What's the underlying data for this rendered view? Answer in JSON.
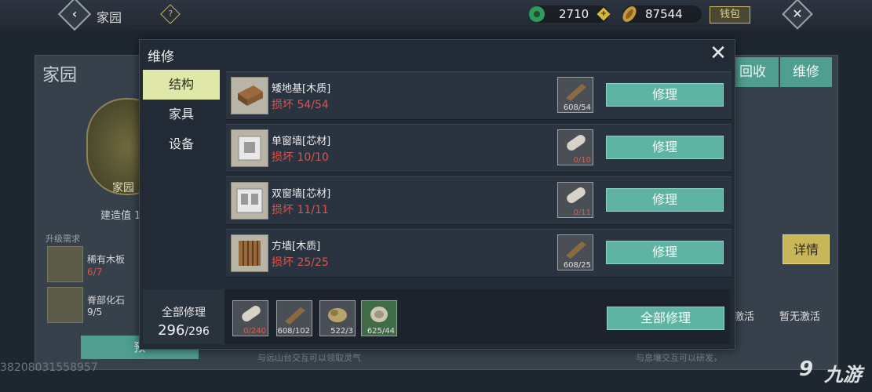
{
  "topbar": {
    "title": "家园",
    "back_icon": "chevron-left-icon",
    "help_icon": "help-icon",
    "jade_value": "2710",
    "coin_value": "87544",
    "wallet_label": "钱包",
    "close_icon": "close-icon"
  },
  "background": {
    "homeland_title": "家园",
    "emblem_label": "家园",
    "build_value": "建造值 1",
    "upgrade_title": "升级需求",
    "items": [
      {
        "name": "稀有木板",
        "count": "6/7"
      },
      {
        "name": "脊部化石",
        "count": "9/5"
      }
    ],
    "preview_label": "预",
    "uid": "38208031558957",
    "recycle_label": "回收",
    "repair_tab_label": "维修",
    "detail_label": "详情",
    "inactive_1": "激活",
    "inactive_2": "暂无激活",
    "hint_1": "与远山台交互可以领取灵气",
    "hint_2": "与息壤交互可以研发，"
  },
  "watermark": {
    "text": "九游",
    "mark": "9"
  },
  "modal": {
    "title": "维修",
    "tabs": [
      {
        "label": "结构",
        "active": true
      },
      {
        "label": "家具",
        "active": false
      },
      {
        "label": "设备",
        "active": false
      }
    ],
    "rows": [
      {
        "name": "矮地基[木质]",
        "damage": "损坏 54/54",
        "icon": "wood-foundation-icon",
        "material_icon": "wood-plank-icon",
        "material_count": "608/54",
        "material_red": false,
        "button": "修理"
      },
      {
        "name": "单窗墙[芯材]",
        "damage": "损坏 10/10",
        "icon": "single-window-wall-icon",
        "material_icon": "core-material-icon",
        "material_count": "0/10",
        "material_red": true,
        "button": "修理"
      },
      {
        "name": "双窗墙[芯材]",
        "damage": "损坏 11/11",
        "icon": "double-window-wall-icon",
        "material_icon": "core-material-icon",
        "material_count": "0/11",
        "material_red": true,
        "button": "修理"
      },
      {
        "name": "方墙[木质]",
        "damage": "损坏 25/25",
        "icon": "wood-wall-icon",
        "material_icon": "wood-plank-icon",
        "material_count": "608/25",
        "material_red": false,
        "button": "修理"
      }
    ],
    "footer": {
      "repair_all_label": "全部修理",
      "total_current": "296",
      "total_max": "/296",
      "materials": [
        {
          "icon": "core-material-icon",
          "count": "0/240",
          "red": true
        },
        {
          "icon": "wood-plank-icon",
          "count": "608/102",
          "red": false
        },
        {
          "icon": "ore-icon",
          "count": "522/3",
          "red": false
        },
        {
          "icon": "rope-icon",
          "count": "625/44",
          "red": false
        }
      ],
      "button": "全部修理"
    }
  }
}
